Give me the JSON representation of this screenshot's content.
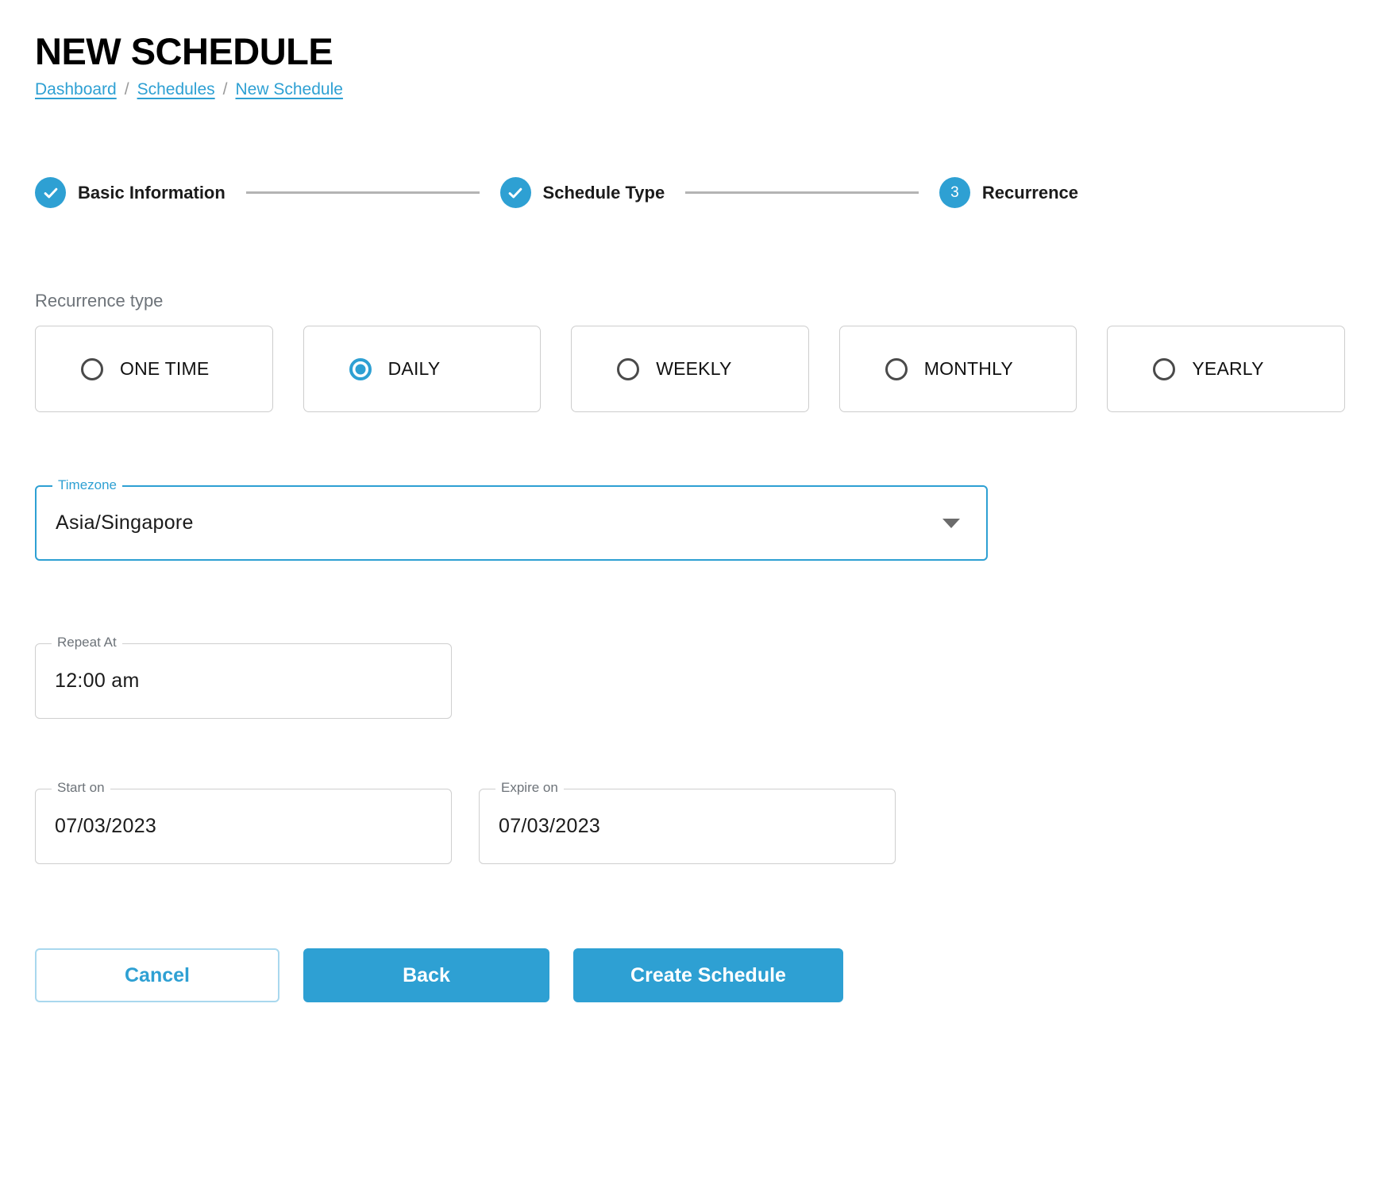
{
  "header": {
    "title": "NEW SCHEDULE",
    "breadcrumb": [
      {
        "label": "Dashboard",
        "type": "link"
      },
      {
        "label": "/",
        "type": "separator"
      },
      {
        "label": "Schedules",
        "type": "link"
      },
      {
        "label": "/",
        "type": "separator"
      },
      {
        "label": "New Schedule",
        "type": "link"
      }
    ]
  },
  "stepper": {
    "steps": [
      {
        "marker": "check",
        "label": "Basic Information",
        "state": "completed"
      },
      {
        "marker": "check",
        "label": "Schedule Type",
        "state": "completed"
      },
      {
        "marker": "3",
        "label": "Recurrence",
        "state": "active"
      }
    ]
  },
  "recurrence": {
    "section_label": "Recurrence type",
    "options": [
      {
        "label": "ONE TIME",
        "selected": false
      },
      {
        "label": "DAILY",
        "selected": true
      },
      {
        "label": "WEEKLY",
        "selected": false
      },
      {
        "label": "MONTHLY",
        "selected": false
      },
      {
        "label": "YEARLY",
        "selected": false
      }
    ]
  },
  "fields": {
    "timezone": {
      "legend": "Timezone",
      "value": "Asia/Singapore",
      "focused": true,
      "icon": "chevron-down-icon"
    },
    "repeat_at": {
      "legend": "Repeat At",
      "value": "12:00 am",
      "focused": false
    },
    "start_on": {
      "legend": "Start on",
      "value": "07/03/2023",
      "focused": false
    },
    "expire_on": {
      "legend": "Expire on",
      "value": "07/03/2023",
      "focused": false
    }
  },
  "actions": {
    "cancel_label": "Cancel",
    "back_label": "Back",
    "create_label": "Create Schedule"
  },
  "colors": {
    "accent": "#2ea0d3",
    "accent_soft": "#a9d8ee",
    "muted_text": "#6d7379",
    "border": "#cfcfcf",
    "step_line": "#b4b4b4"
  }
}
